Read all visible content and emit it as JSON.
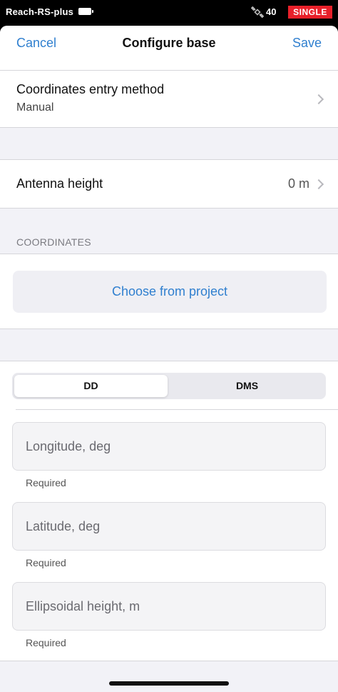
{
  "status_bar": {
    "device_name": "Reach-RS-plus",
    "battery_icon": "battery-icon",
    "satellite_icon": "satellite-icon",
    "satellite_count": "40",
    "solution_mode": "SINGLE",
    "solution_color": "#e8202a"
  },
  "nav": {
    "cancel_label": "Cancel",
    "title": "Configure base",
    "save_label": "Save",
    "accent_color": "#2f7fcf"
  },
  "coordinates_entry": {
    "title": "Coordinates entry method",
    "value": "Manual"
  },
  "antenna": {
    "title": "Antenna height",
    "value": "0 m"
  },
  "coordinates_section": {
    "header": "COORDINATES",
    "choose_button": "Choose from project",
    "format_tabs": [
      {
        "label": "DD",
        "selected": true
      },
      {
        "label": "DMS",
        "selected": false
      }
    ],
    "fields": [
      {
        "placeholder": "Longitude, deg",
        "value": "",
        "helper": "Required"
      },
      {
        "placeholder": "Latitude, deg",
        "value": "",
        "helper": "Required"
      },
      {
        "placeholder": "Ellipsoidal height, m",
        "value": "",
        "helper": "Required"
      }
    ]
  }
}
